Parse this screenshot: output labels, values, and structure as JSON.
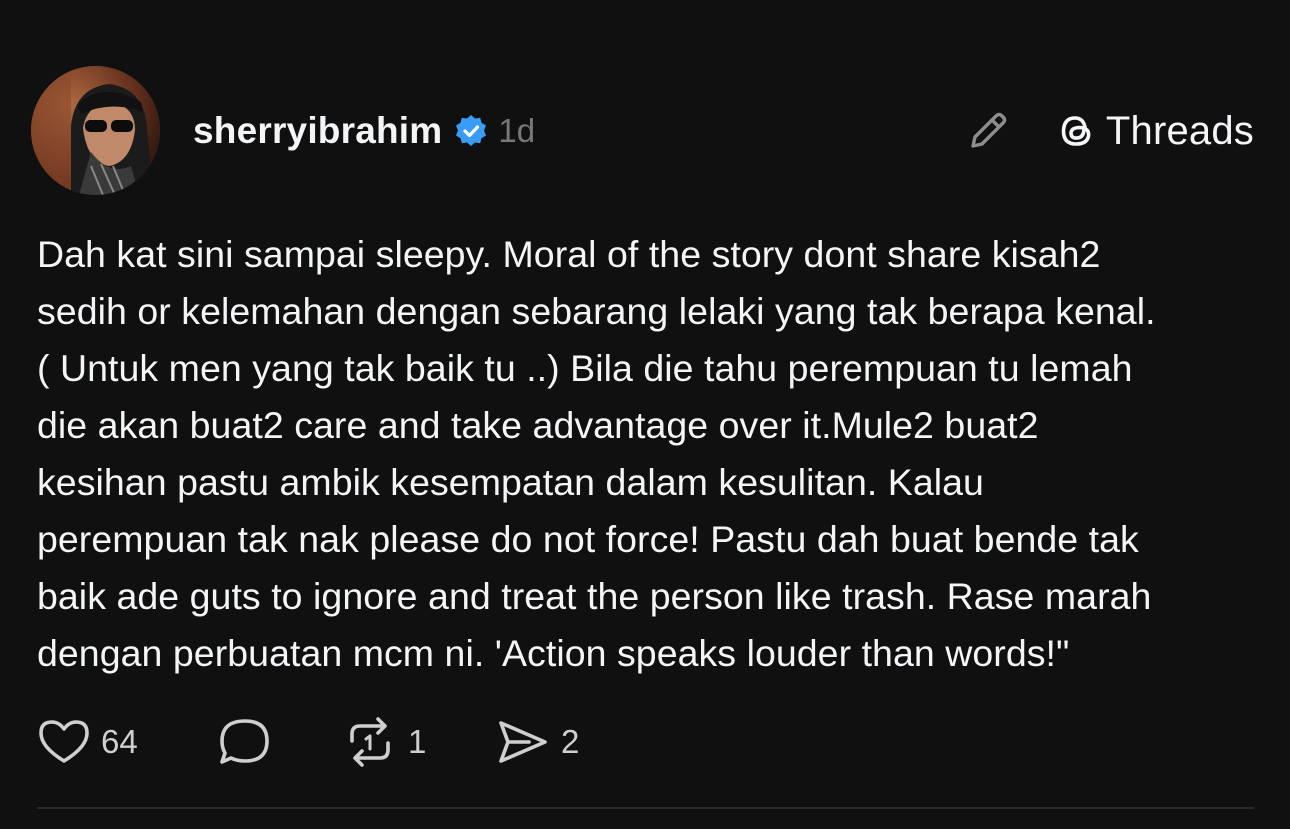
{
  "post": {
    "author": {
      "username": "sherryibrahim",
      "verified": true,
      "verified_color": "#3b9cf6",
      "time_ago": "1d"
    },
    "brand": {
      "icon": "threads-logo-icon",
      "label": "Threads"
    },
    "text_lines": [
      "Dah kat sini sampai sleepy. Moral of the story dont share kisah2",
      "sedih or kelemahan dengan sebarang lelaki yang tak berapa kenal.",
      "( Untuk men yang tak baik tu ..) Bila die tahu perempuan tu lemah",
      "die akan buat2 care and take advantage over it.Mule2 buat2",
      "kesihan pastu ambik kesempatan dalam kesulitan. Kalau",
      "perempuan tak nak please do not force! Pastu dah buat bende tak",
      "baik ade guts to ignore and treat the person like trash. Rase marah",
      "dengan perbuatan mcm ni. 'Action speaks louder than words!\""
    ],
    "actions": {
      "like": {
        "icon": "heart-icon",
        "count": "64"
      },
      "reply": {
        "icon": "comment-icon",
        "count": ""
      },
      "repost": {
        "icon": "repost-icon",
        "count": "1"
      },
      "share": {
        "icon": "send-icon",
        "count": "2"
      }
    }
  },
  "colors": {
    "background": "#101010",
    "text": "#f3f5f7",
    "muted": "#777777"
  }
}
